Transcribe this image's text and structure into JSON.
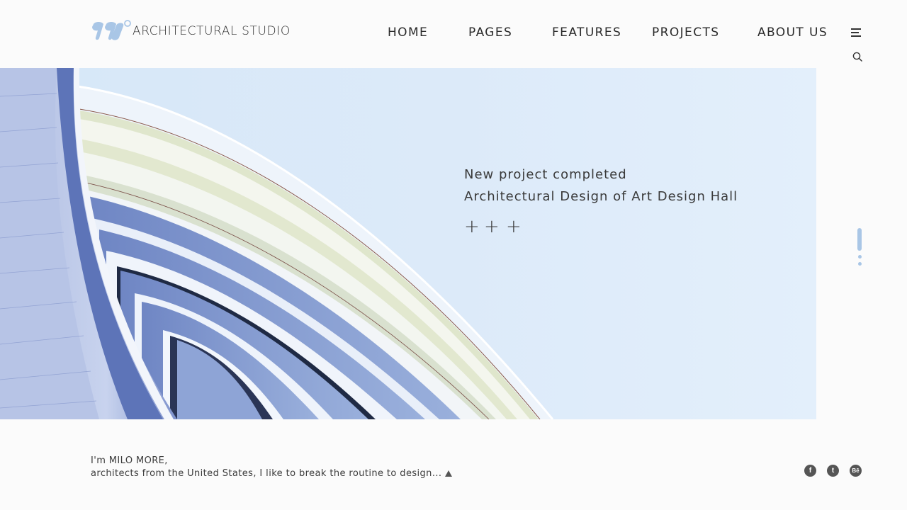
{
  "brand": {
    "studio_name": "ARCHITECTURAL STUDIO",
    "logo_icon": "logo-90-degree-mark",
    "accent_color": "#a9c6e6"
  },
  "nav": {
    "items": [
      {
        "label": "HOME"
      },
      {
        "label": "PAGES"
      },
      {
        "label": "FEATURES"
      },
      {
        "label": "PROJECTS"
      },
      {
        "label": "ABOUT US"
      }
    ],
    "menu_icon": "hamburger-menu-icon",
    "search_icon": "search-icon"
  },
  "hero": {
    "line1": "New project completed",
    "line2": "Architectural Design of  Art Design Hall",
    "plus_symbol": "+",
    "slides_total": 3,
    "active_slide": 1
  },
  "footer": {
    "bio_line1": "I'm MILO MORE,",
    "bio_line2": "architects from the United States, I like to break the routine to design...",
    "social": [
      {
        "name": "facebook",
        "glyph": "f"
      },
      {
        "name": "twitter",
        "glyph": "t"
      },
      {
        "name": "behance",
        "glyph": "Bē"
      }
    ]
  }
}
